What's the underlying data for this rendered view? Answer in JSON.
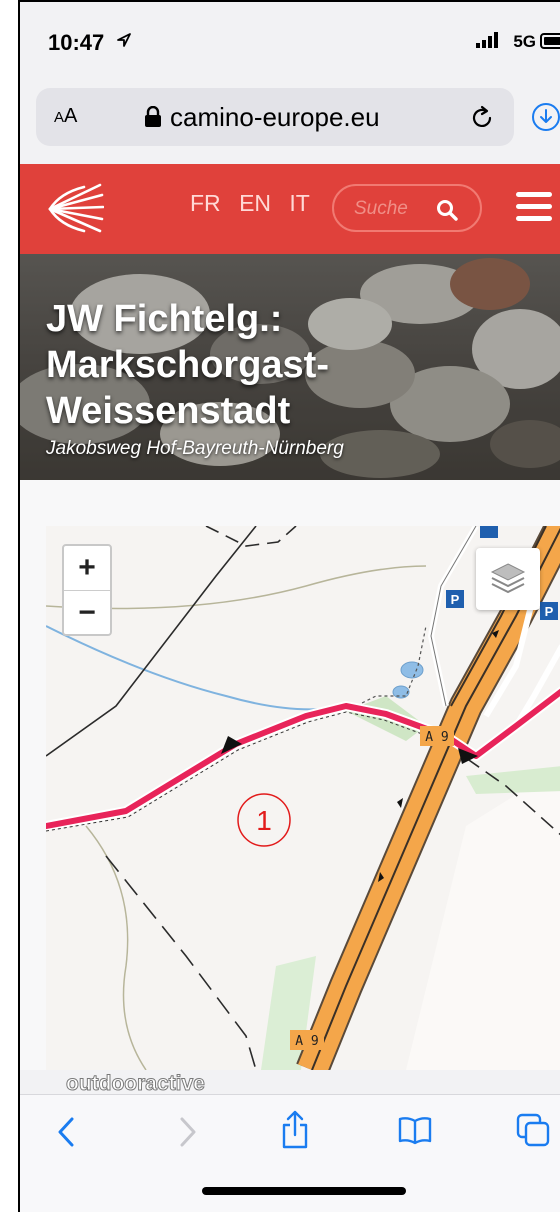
{
  "status_bar": {
    "time": "10:47",
    "network": "5G"
  },
  "browser": {
    "text_size_label": "AA",
    "domain": "camino-europe.eu"
  },
  "site": {
    "brand_color": "#e0413b",
    "languages": [
      "FR",
      "EN",
      "IT"
    ],
    "search_placeholder": "Suche"
  },
  "hero": {
    "title": "JW Fichtelg.: Markschorgast-Weissenstadt",
    "subtitle": "Jakobsweg Hof-Bayreuth-Nürnberg"
  },
  "map": {
    "zoom_in_label": "+",
    "zoom_out_label": "−",
    "stage_marker": "1",
    "road_label": "A 9",
    "parking_label": "P",
    "attribution": "outdooractive",
    "route_color": "#e8245a",
    "highway_color": "#f4a64a"
  },
  "toolbar": {
    "icons": [
      "back-icon",
      "forward-icon",
      "share-icon",
      "bookmarks-icon",
      "tabs-icon"
    ]
  }
}
